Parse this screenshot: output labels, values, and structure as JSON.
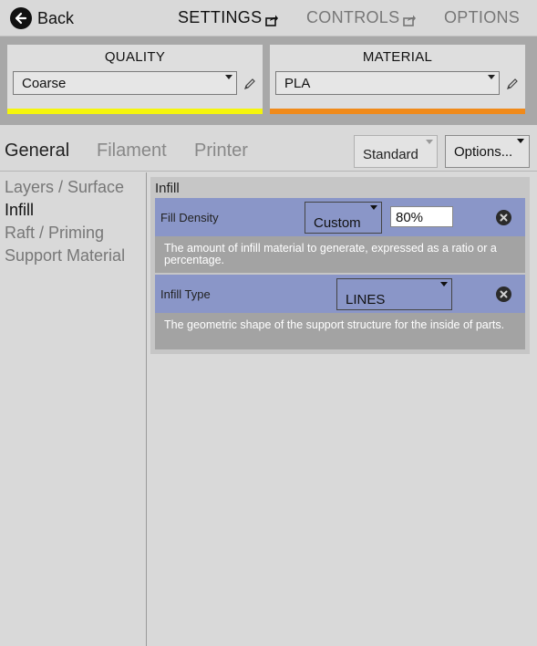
{
  "nav": {
    "back_label": "Back",
    "settings_label": "SETTINGS",
    "controls_label": "CONTROLS",
    "options_label": "OPTIONS",
    "back_icon": "arrow-left-circle-icon",
    "external_icon": "external-link-icon"
  },
  "profiles": {
    "quality": {
      "title": "QUALITY",
      "value": "Coarse",
      "bar_color": "#f5f50c"
    },
    "material": {
      "title": "MATERIAL",
      "value": "PLA",
      "bar_color": "#f08a1a"
    },
    "edit_icon": "pencil-icon"
  },
  "tabs": {
    "general": "General",
    "filament": "Filament",
    "printer": "Printer",
    "mode_value": "Standard",
    "options_label": "Options..."
  },
  "sidebar": {
    "items": [
      {
        "label": "Layers / Surface",
        "active": false
      },
      {
        "label": "Infill",
        "active": true
      },
      {
        "label": "Raft / Priming",
        "active": false
      },
      {
        "label": "Support Material",
        "active": false
      }
    ]
  },
  "section": {
    "title": "Infill",
    "settings": [
      {
        "label": "Fill Density",
        "mode": "Custom",
        "value": "80%",
        "description": "The amount of infill material to generate, expressed as a ratio or a percentage."
      },
      {
        "label": "Infill Type",
        "mode": "LINES",
        "description": "The geometric shape of the support structure for the inside of parts."
      }
    ]
  },
  "colors": {
    "row_background": "#8a96c8",
    "description_background": "#a3a3a3",
    "panel_background": "#a8a8a8"
  }
}
